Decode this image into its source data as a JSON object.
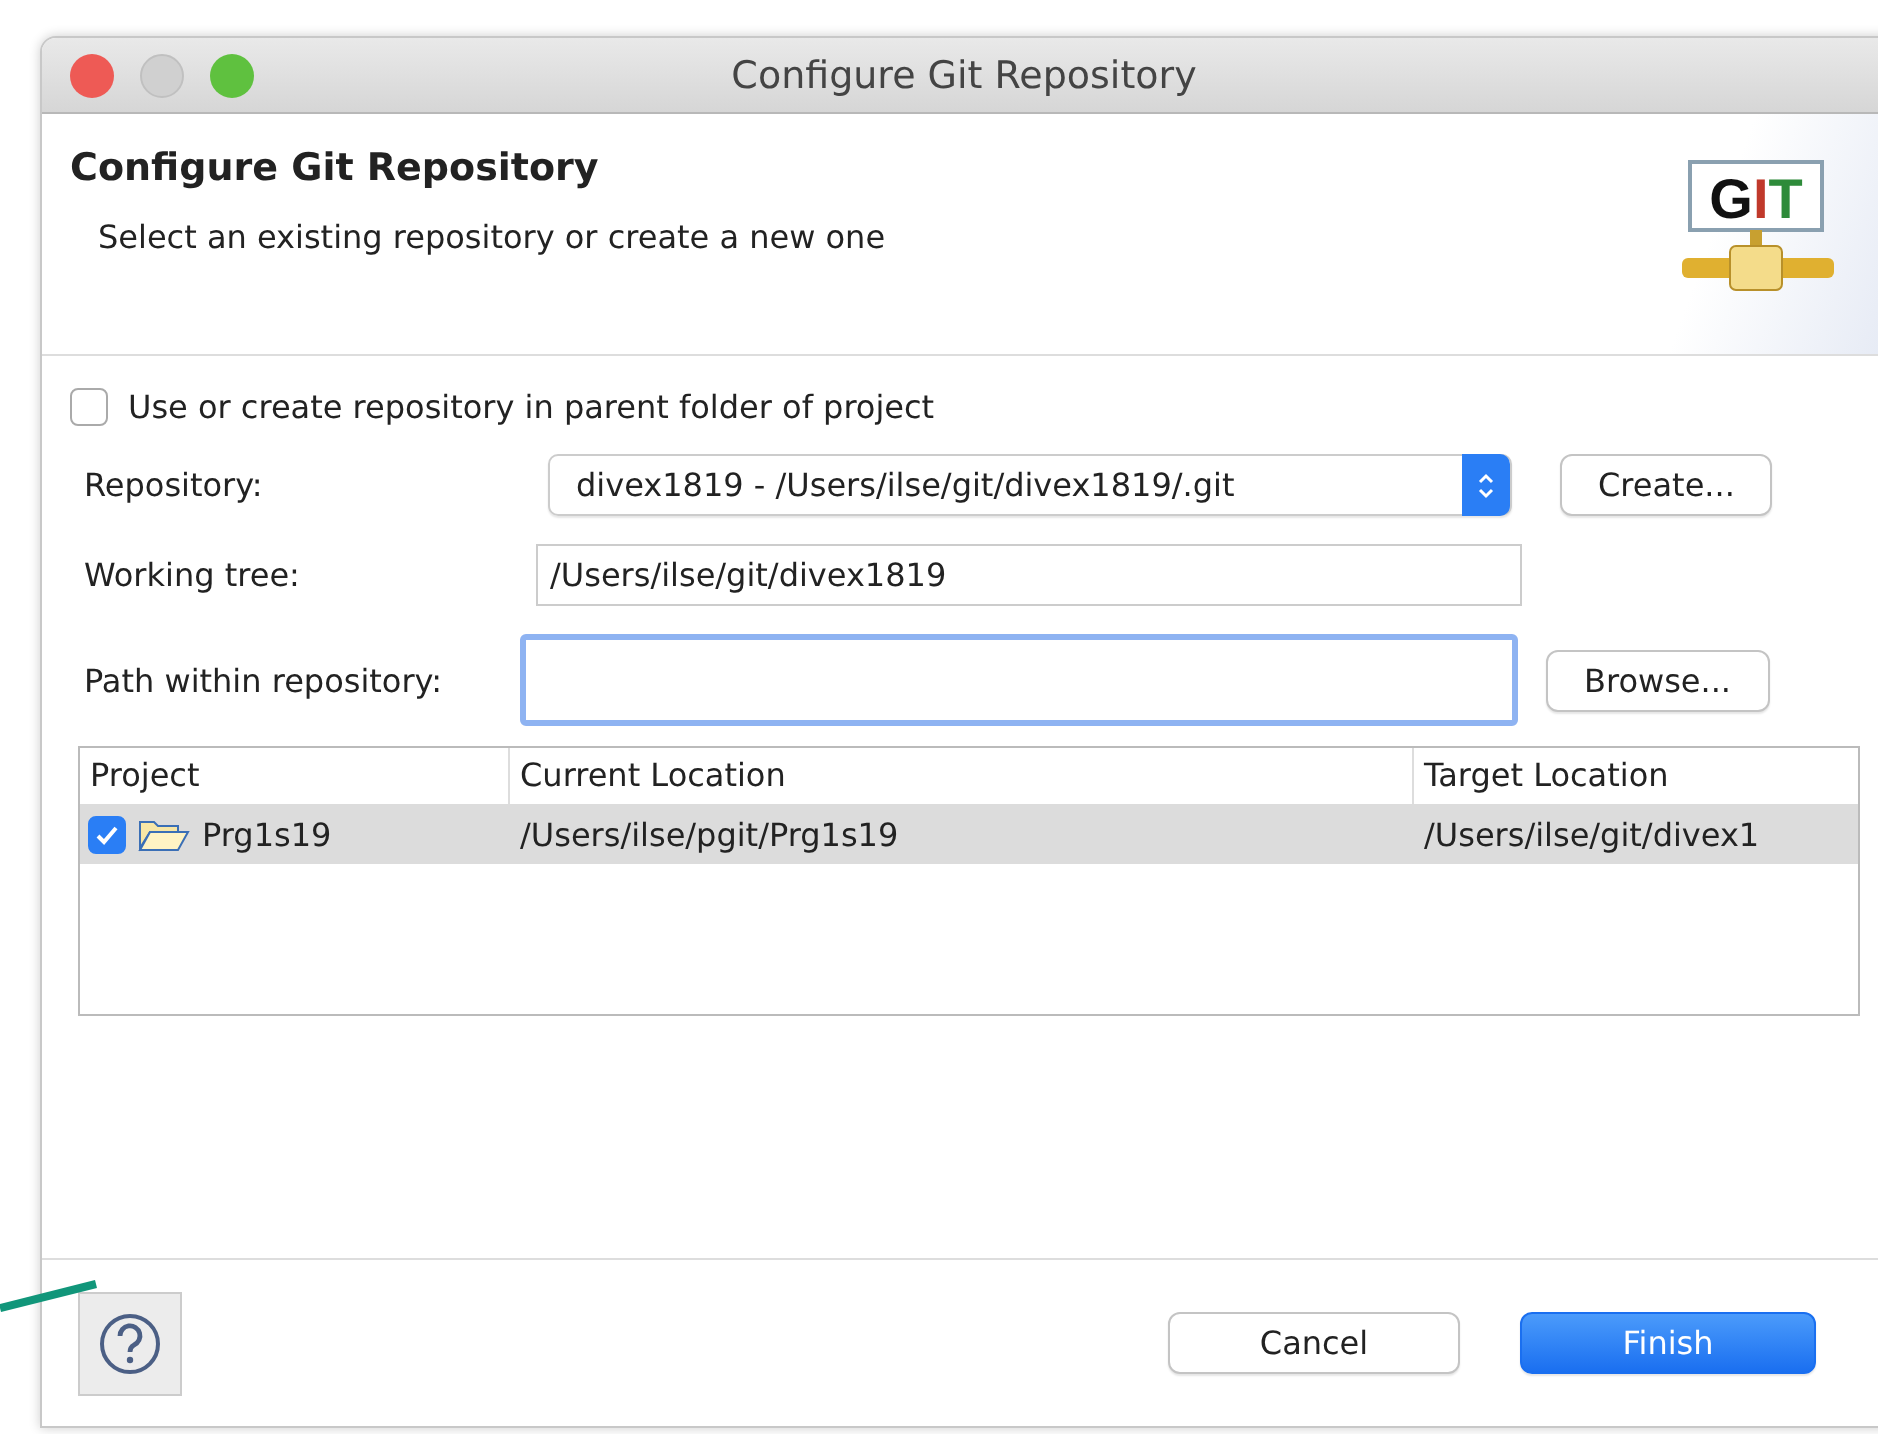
{
  "window": {
    "title": "Configure Git Repository"
  },
  "header": {
    "title": "Configure Git Repository",
    "subtitle": "Select an existing repository or create a new one",
    "logo_letters": [
      {
        "text": "G",
        "color": "#111111"
      },
      {
        "text": "I",
        "color": "#c0392b"
      },
      {
        "text": "T",
        "color": "#2e8b3a"
      }
    ]
  },
  "parent_folder_option": {
    "label": "Use or create repository in parent folder of project",
    "checked": false
  },
  "repository": {
    "label": "Repository:",
    "value": "divex1819 - /Users/ilse/git/divex1819/.git",
    "button": "Create..."
  },
  "working_tree": {
    "label": "Working tree:",
    "value": "/Users/ilse/git/divex1819"
  },
  "path_within_repository": {
    "label": "Path within repository:",
    "button": "Browse..."
  },
  "table": {
    "columns": [
      "Project",
      "Current Location",
      "Target Location"
    ],
    "rows": [
      {
        "project": "Prg1s19",
        "current": "/Users/ilse/pgit/Prg1s19",
        "target": "/Users/ilse/git/divex1",
        "checked": true,
        "selected": true
      }
    ]
  },
  "buttons": {
    "cancel": "Cancel",
    "finish": "Finish"
  }
}
